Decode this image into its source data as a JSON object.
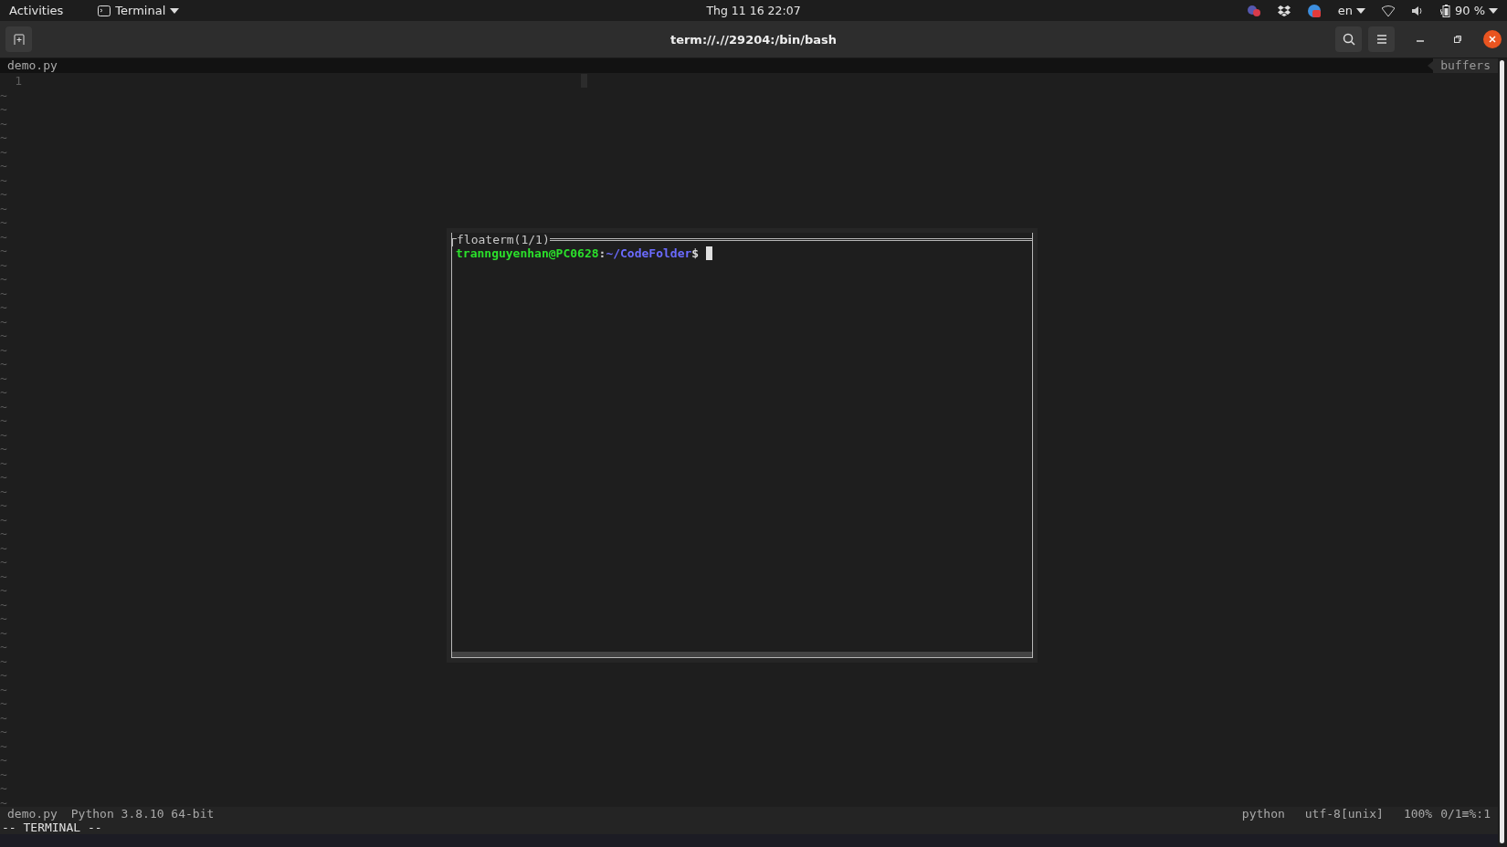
{
  "top_bar": {
    "activities": "Activities",
    "app_menu": "Terminal",
    "clock": "Thg 11 16  22:07",
    "language": "en",
    "battery": "90 %"
  },
  "window": {
    "title": "term://.//29204:/bin/bash"
  },
  "editor": {
    "tab": "demo.py",
    "buffers_label": "buffers",
    "line_numbers": [
      "1"
    ],
    "tildes": [
      "~",
      "~",
      "~",
      "~",
      "~",
      "~",
      "~",
      "~",
      "~",
      "~",
      "~",
      "~",
      "~",
      "~",
      "~",
      "~",
      "~",
      "~",
      "~",
      "~",
      "~",
      "~",
      "~",
      "~",
      "~",
      "~",
      "~",
      "~",
      "~",
      "~",
      "~",
      "~",
      "~",
      "~",
      "~",
      "~",
      "~",
      "~",
      "~",
      "~",
      "~",
      "~",
      "~",
      "~",
      "~",
      "~",
      "~",
      "~",
      "~",
      "~",
      "~"
    ]
  },
  "floaterm": {
    "title": "floaterm(1/1)",
    "prompt_user": "trannguyenhan@PC0628",
    "prompt_sep": ":",
    "prompt_path": "~/CodeFolder",
    "prompt_symbol": "$"
  },
  "status_line": {
    "file": "demo.py",
    "interpreter": "Python 3.8.10 64-bit",
    "filetype": "python",
    "encoding": "utf-8[unix]",
    "percent": "100%",
    "position": "0/1≡%:1"
  },
  "mode": "-- TERMINAL --"
}
